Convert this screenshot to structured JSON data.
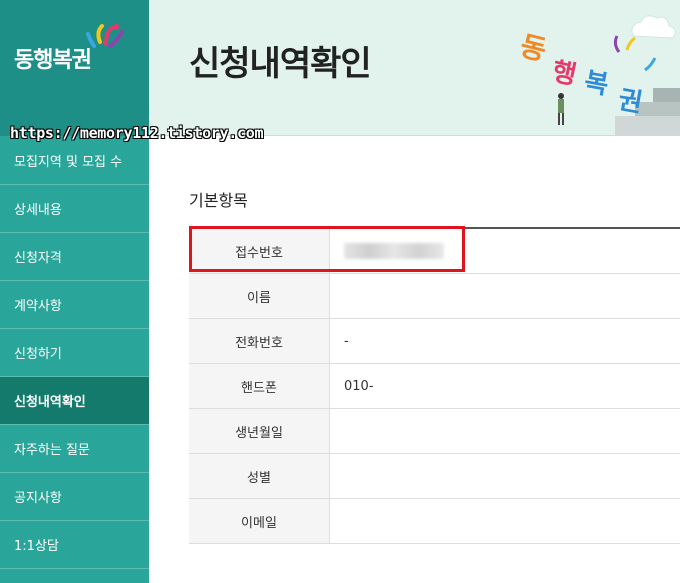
{
  "logo": {
    "text": "동행복권"
  },
  "watermark": {
    "text": "https://memory112.tistory.com"
  },
  "sidebar": {
    "items": [
      {
        "label": "모집지역 및 모집 수",
        "active": false
      },
      {
        "label": "상세내용",
        "active": false
      },
      {
        "label": "신청자격",
        "active": false
      },
      {
        "label": "계약사항",
        "active": false
      },
      {
        "label": "신청하기",
        "active": false
      },
      {
        "label": "신청내역확인",
        "active": true
      },
      {
        "label": "자주하는 질문",
        "active": false
      },
      {
        "label": "공지사항",
        "active": false
      },
      {
        "label": "1:1상담",
        "active": false
      }
    ]
  },
  "header": {
    "title": "신청내역확인",
    "art_text": "동행복권"
  },
  "section": {
    "title": "기본항목"
  },
  "table": {
    "rows": [
      {
        "label": "접수번호",
        "value": ""
      },
      {
        "label": "이름",
        "value": ""
      },
      {
        "label": "전화번호",
        "value": "-"
      },
      {
        "label": "핸드폰",
        "value": "010-"
      },
      {
        "label": "생년월일",
        "value": ""
      },
      {
        "label": "성별",
        "value": ""
      },
      {
        "label": "이메일",
        "value": ""
      }
    ]
  },
  "colors": {
    "sidebar": "#2aa59a",
    "sidebar_active": "#137a6c",
    "header_bg": "#e2f3ee",
    "highlight": "#e0141e"
  }
}
